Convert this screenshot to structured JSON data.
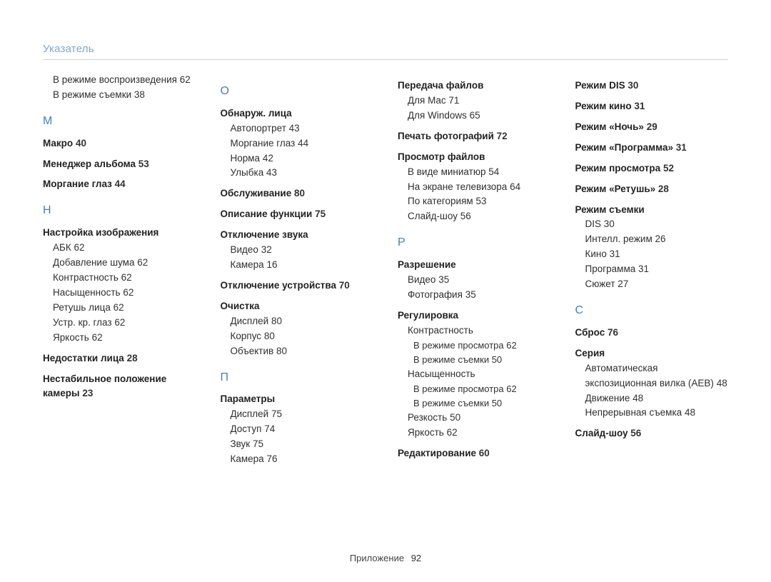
{
  "header": "Указатель",
  "footer_label": "Приложение",
  "footer_page": "92",
  "columns": [
    {
      "blocks": [
        {
          "kind": "sub",
          "text": "В режиме воспроизведения",
          "page": "62"
        },
        {
          "kind": "sub",
          "text": "В режиме съемки",
          "page": "38"
        },
        {
          "kind": "letter",
          "text": "М"
        },
        {
          "kind": "entry",
          "text": "Макро",
          "page": "40"
        },
        {
          "kind": "entry",
          "text": "Менеджер альбома",
          "page": "53"
        },
        {
          "kind": "entry",
          "text": "Моргание глаз",
          "page": "44"
        },
        {
          "kind": "letter",
          "text": "Н"
        },
        {
          "kind": "entry",
          "text": "Настройка изображения"
        },
        {
          "kind": "sub",
          "text": "АБК",
          "page": "62"
        },
        {
          "kind": "sub",
          "text": "Добавление шума",
          "page": "62"
        },
        {
          "kind": "sub",
          "text": "Контрастность",
          "page": "62"
        },
        {
          "kind": "sub",
          "text": "Насыщенность",
          "page": "62"
        },
        {
          "kind": "sub",
          "text": "Ретушь лица",
          "page": "62"
        },
        {
          "kind": "sub",
          "text": "Устр. кр. глаз",
          "page": "62"
        },
        {
          "kind": "sub",
          "text": "Яркость",
          "page": "62"
        },
        {
          "kind": "entry",
          "text": "Недостатки лица",
          "page": "28"
        },
        {
          "kind": "entry",
          "text": "Нестабильное положение камеры",
          "page": "23"
        }
      ]
    },
    {
      "blocks": [
        {
          "kind": "letter",
          "text": "О"
        },
        {
          "kind": "entry",
          "text": "Обнаруж. лица"
        },
        {
          "kind": "sub",
          "text": "Автопортрет",
          "page": "43"
        },
        {
          "kind": "sub",
          "text": "Моргание глаз",
          "page": "44"
        },
        {
          "kind": "sub",
          "text": "Норма",
          "page": "42"
        },
        {
          "kind": "sub",
          "text": "Улыбка",
          "page": "43"
        },
        {
          "kind": "entry",
          "text": "Обслуживание",
          "page": "80"
        },
        {
          "kind": "entry",
          "text": "Описание функции",
          "page": "75"
        },
        {
          "kind": "entry",
          "text": "Отключение звука"
        },
        {
          "kind": "sub",
          "text": "Видео",
          "page": "32"
        },
        {
          "kind": "sub",
          "text": "Камера",
          "page": "16"
        },
        {
          "kind": "entry",
          "text": "Отключение устройства",
          "page": "70"
        },
        {
          "kind": "entry",
          "text": "Очистка"
        },
        {
          "kind": "sub",
          "text": "Дисплей",
          "page": "80"
        },
        {
          "kind": "sub",
          "text": "Корпус",
          "page": "80"
        },
        {
          "kind": "sub",
          "text": "Объектив",
          "page": "80"
        },
        {
          "kind": "letter",
          "text": "П"
        },
        {
          "kind": "entry",
          "text": "Параметры"
        },
        {
          "kind": "sub",
          "text": "Дисплей",
          "page": "75"
        },
        {
          "kind": "sub",
          "text": "Доступ",
          "page": "74"
        },
        {
          "kind": "sub",
          "text": "Звук",
          "page": "75"
        },
        {
          "kind": "sub",
          "text": "Камера",
          "page": "76"
        }
      ]
    },
    {
      "blocks": [
        {
          "kind": "entry",
          "text": "Передача файлов"
        },
        {
          "kind": "sub",
          "text": "Для Mac",
          "page": "71"
        },
        {
          "kind": "sub",
          "text": "Для Windows",
          "page": "65"
        },
        {
          "kind": "entry",
          "text": "Печать фотографий",
          "page": "72"
        },
        {
          "kind": "entry",
          "text": "Просмотр файлов"
        },
        {
          "kind": "sub",
          "text": "В виде миниатюр",
          "page": "54"
        },
        {
          "kind": "sub",
          "text": "На экране телевизора",
          "page": "64"
        },
        {
          "kind": "sub",
          "text": "По категориям",
          "page": "53"
        },
        {
          "kind": "sub",
          "text": "Слайд-шоу",
          "page": "56"
        },
        {
          "kind": "letter",
          "text": "Р"
        },
        {
          "kind": "entry",
          "text": "Разрешение"
        },
        {
          "kind": "sub",
          "text": "Видео",
          "page": "35"
        },
        {
          "kind": "sub",
          "text": "Фотография",
          "page": "35"
        },
        {
          "kind": "entry",
          "text": "Регулировка"
        },
        {
          "kind": "sub",
          "text": "Контрастность"
        },
        {
          "kind": "sub2",
          "text": "В режиме просмотра",
          "page": "62"
        },
        {
          "kind": "sub2",
          "text": "В режиме съемки",
          "page": "50"
        },
        {
          "kind": "sub",
          "text": "Насыщенность"
        },
        {
          "kind": "sub2",
          "text": "В режиме просмотра",
          "page": "62"
        },
        {
          "kind": "sub2",
          "text": "В режиме съемки",
          "page": "50"
        },
        {
          "kind": "sub",
          "text": "Резкость",
          "page": "50"
        },
        {
          "kind": "sub",
          "text": "Яркость",
          "page": "62"
        },
        {
          "kind": "entry",
          "text": "Редактирование",
          "page": "60"
        }
      ]
    },
    {
      "blocks": [
        {
          "kind": "entry",
          "text": "Режим DIS",
          "page": "30"
        },
        {
          "kind": "entry",
          "text": "Режим кино",
          "page": "31"
        },
        {
          "kind": "entry",
          "text": "Режим «Ночь»",
          "page": "29"
        },
        {
          "kind": "entry",
          "text": "Режим «Программа»",
          "page": "31"
        },
        {
          "kind": "entry",
          "text": "Режим просмотра",
          "page": "52"
        },
        {
          "kind": "entry",
          "text": "Режим «Ретушь»",
          "page": "28"
        },
        {
          "kind": "entry",
          "text": "Режим съемки"
        },
        {
          "kind": "sub",
          "text": "DIS",
          "page": "30"
        },
        {
          "kind": "sub",
          "text": "Интелл. режим",
          "page": "26"
        },
        {
          "kind": "sub",
          "text": "Кино",
          "page": "31"
        },
        {
          "kind": "sub",
          "text": "Программа",
          "page": "31"
        },
        {
          "kind": "sub",
          "text": "Сюжет",
          "page": "27"
        },
        {
          "kind": "letter",
          "text": "С"
        },
        {
          "kind": "entry",
          "text": "Сброс",
          "page": "76"
        },
        {
          "kind": "entry",
          "text": "Серия"
        },
        {
          "kind": "sub",
          "text": "Автоматическая экспозиционная вилка (AEB)",
          "page": "48"
        },
        {
          "kind": "sub",
          "text": "Движение",
          "page": "48"
        },
        {
          "kind": "sub",
          "text": "Непрерывная съемка",
          "page": "48"
        },
        {
          "kind": "entry",
          "text": "Слайд-шоу",
          "page": "56"
        }
      ]
    }
  ]
}
